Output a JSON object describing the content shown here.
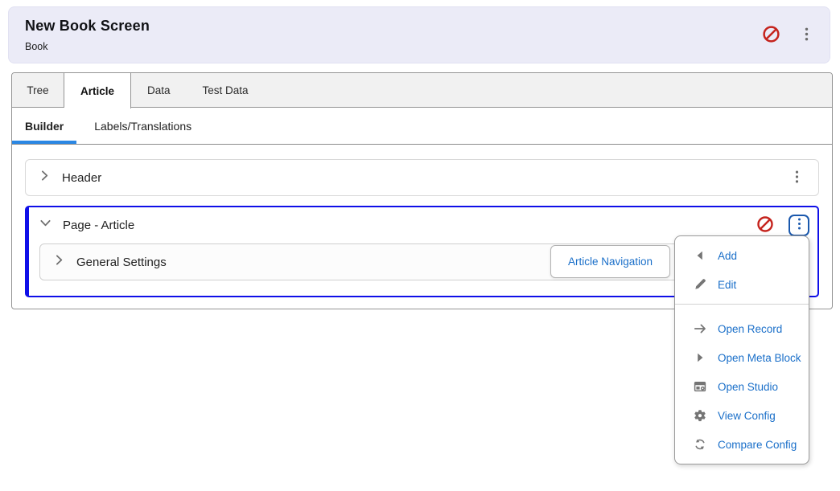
{
  "banner": {
    "title": "New Book Screen",
    "subtitle": "Book"
  },
  "tabs": {
    "active": "Article",
    "items": [
      {
        "label": "Tree"
      },
      {
        "label": "Article"
      },
      {
        "label": "Data"
      },
      {
        "label": "Test Data"
      }
    ]
  },
  "subtabs": {
    "active": "Builder",
    "items": [
      {
        "label": "Builder"
      },
      {
        "label": "Labels/Translations"
      }
    ]
  },
  "builder": {
    "header_section_label": "Header",
    "page_section_label": "Page - Article",
    "general_settings_label": "General Settings",
    "article_navigation_label": "Article Navigation"
  },
  "context_menu": {
    "items": [
      {
        "label": "Add",
        "icon": "triangle-left-icon"
      },
      {
        "label": "Edit",
        "icon": "pencil-icon"
      },
      {
        "label": "Open Record",
        "icon": "arrow-right-icon"
      },
      {
        "label": "Open Meta Block",
        "icon": "triangle-right-icon"
      },
      {
        "label": "Open Studio",
        "icon": "studio-icon"
      },
      {
        "label": "View Config",
        "icon": "gear-icon"
      },
      {
        "label": "Compare Config",
        "icon": "compare-icon"
      }
    ],
    "divider_after": "Edit"
  },
  "colors": {
    "banner_bg": "#ebebf7",
    "link_blue": "#1a6fc9",
    "active_panel_border_blue": "#0f0fe8",
    "subtab_underline_blue": "#2b87e3",
    "ban_red": "#c5231d",
    "kebab_focus_blue": "#1a58ad",
    "icon_gray": "#757575"
  }
}
